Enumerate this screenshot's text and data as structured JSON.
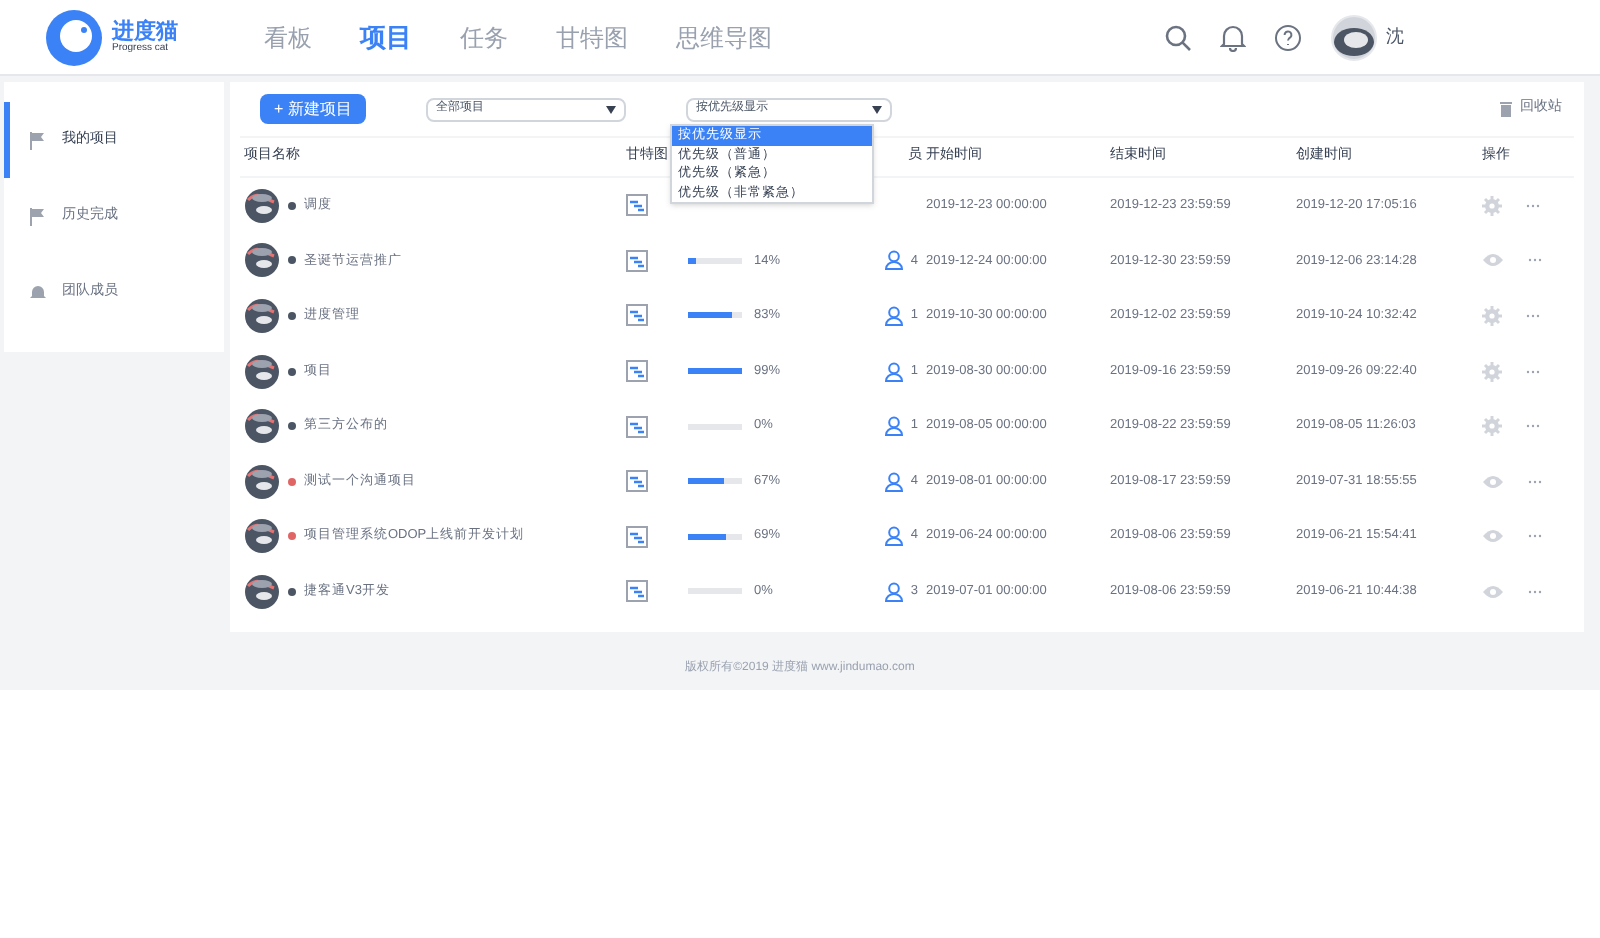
{
  "header": {
    "logo_title": "进度猫",
    "logo_subtitle": "Progress cat",
    "nav": [
      {
        "label": "看板",
        "selected": false
      },
      {
        "label": "项目",
        "selected": true
      },
      {
        "label": "任务",
        "selected": false
      },
      {
        "label": "甘特图",
        "selected": false
      },
      {
        "label": "思维导图",
        "selected": false
      }
    ],
    "user_name": "沈"
  },
  "sidebar": {
    "items": [
      {
        "label": "我的项目",
        "selected": true,
        "kind": "flag"
      },
      {
        "label": "历史完成",
        "selected": false,
        "kind": "flag"
      },
      {
        "label": "团队成员",
        "selected": false,
        "kind": "bell"
      }
    ]
  },
  "toolbar": {
    "new_button": "+ 新建项目",
    "filter_select": "全部项目",
    "sort_select": "按优先级显示",
    "sort_options": [
      {
        "label": "按优先级显示",
        "selected": true
      },
      {
        "label": "优先级（普通）",
        "selected": false
      },
      {
        "label": "优先级（紧急）",
        "selected": false
      },
      {
        "label": "优先级（非常紧急）",
        "selected": false
      }
    ],
    "recycle": "回收站"
  },
  "table": {
    "columns": [
      "项目名称",
      "甘特图",
      "员",
      "开始时间",
      "结束时间",
      "创建时间",
      "操作"
    ],
    "rows": [
      {
        "name": "调度",
        "color": "#4b5563",
        "start": "2019-12-23 00:00:00",
        "end": "2019-12-23 23:59:59",
        "created": "2019-12-20 17:05:16",
        "kind": "gear"
      },
      {
        "name": "圣诞节运营推广",
        "color": "#4b5563",
        "level": 0.14,
        "percent": "14%",
        "members": "4",
        "start": "2019-12-24 00:00:00",
        "end": "2019-12-30 23:59:59",
        "created": "2019-12-06 23:14:28",
        "kind": "eye"
      },
      {
        "name": "进度管理",
        "color": "#4b5563",
        "level": 0.83,
        "percent": "83%",
        "members": "1",
        "start": "2019-10-30 00:00:00",
        "end": "2019-12-02 23:59:59",
        "created": "2019-10-24 10:32:42",
        "kind": "gear"
      },
      {
        "name": "项目",
        "color": "#4b5563",
        "level": 0.99,
        "percent": "99%",
        "members": "1",
        "start": "2019-08-30 00:00:00",
        "end": "2019-09-16 23:59:59",
        "created": "2019-09-26 09:22:40",
        "kind": "gear"
      },
      {
        "name": "第三方公布的",
        "color": "#4b5563",
        "level": 0,
        "percent": "0%",
        "members": "1",
        "start": "2019-08-05 00:00:00",
        "end": "2019-08-22 23:59:59",
        "created": "2019-08-05 11:26:03",
        "kind": "gear"
      },
      {
        "name": "测试一个沟通项目",
        "color": "#e06666",
        "level": 0.67,
        "percent": "67%",
        "members": "4",
        "start": "2019-08-01 00:00:00",
        "end": "2019-08-17 23:59:59",
        "created": "2019-07-31 18:55:55",
        "kind": "eye"
      },
      {
        "name": "项目管理系统ODOP上线前开发计划",
        "color": "#e06666",
        "level": 0.69,
        "percent": "69%",
        "members": "4",
        "start": "2019-06-24 00:00:00",
        "end": "2019-08-06 23:59:59",
        "created": "2019-06-21 15:54:41",
        "kind": "eye"
      },
      {
        "name": "捷客通V3开发",
        "color": "#4b5563",
        "level": 0,
        "percent": "0%",
        "members": "3",
        "start": "2019-07-01 00:00:00",
        "end": "2019-08-06 23:59:59",
        "created": "2019-06-21 10:44:38",
        "kind": "eye"
      }
    ]
  },
  "footer": "版权所有©2019 进度猫 www.jindumao.com"
}
